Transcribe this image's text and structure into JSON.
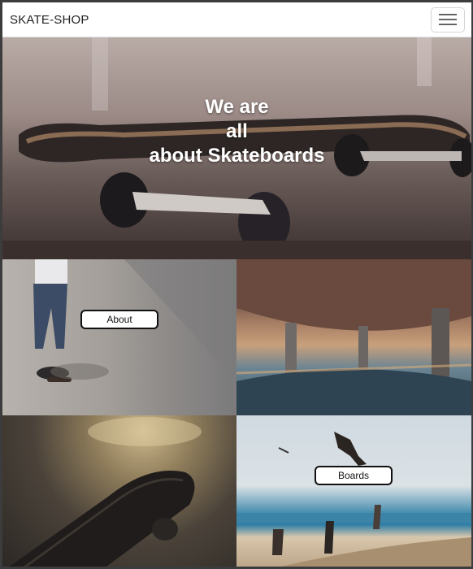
{
  "navbar": {
    "brand": "SKATE-SHOP",
    "toggle_icon": "hamburger-menu-icon"
  },
  "hero": {
    "title": "We are\nall\nabout Skateboards"
  },
  "tiles": {
    "about_label": "About",
    "boards_label": "Boards"
  }
}
